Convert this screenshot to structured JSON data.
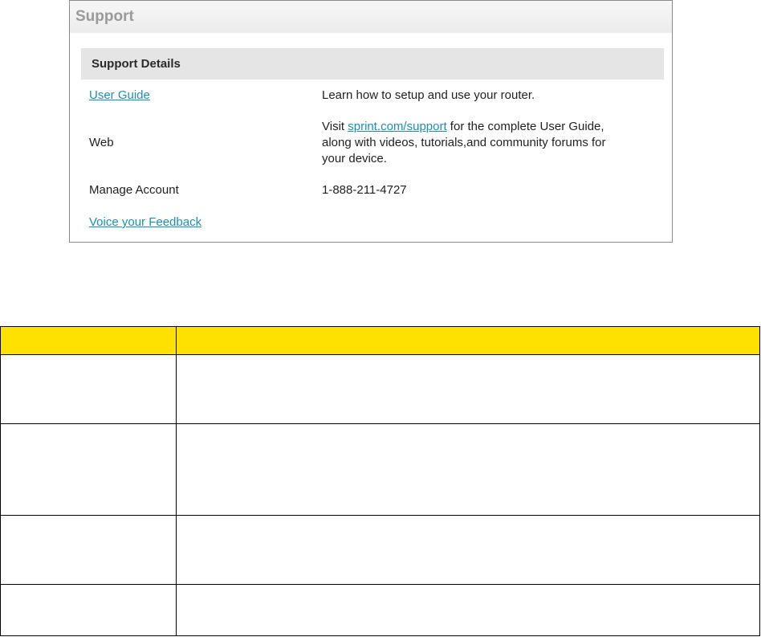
{
  "panel": {
    "title": "Support",
    "details_header": "Support Details",
    "rows": {
      "user_guide": {
        "label": "User Guide",
        "value": "Learn how to setup and use your router."
      },
      "web": {
        "label": "Web",
        "value_prefix": "Visit",
        "value_link": "sprint.com/support",
        "value_line1_suffix": " for the complete User Guide,",
        "value_line2": "along with videos, tutorials,and community forums for",
        "value_line3": "your device."
      },
      "manage_account": {
        "label": "Manage Account",
        "value": "1-888-211-4727"
      },
      "feedback": {
        "label": "Voice your Feedback"
      }
    }
  },
  "table": {
    "header_color": "#ffe100",
    "headers": [
      "",
      ""
    ],
    "rows": [
      [
        "",
        ""
      ],
      [
        "",
        ""
      ],
      [
        "",
        ""
      ],
      [
        "",
        ""
      ]
    ]
  }
}
